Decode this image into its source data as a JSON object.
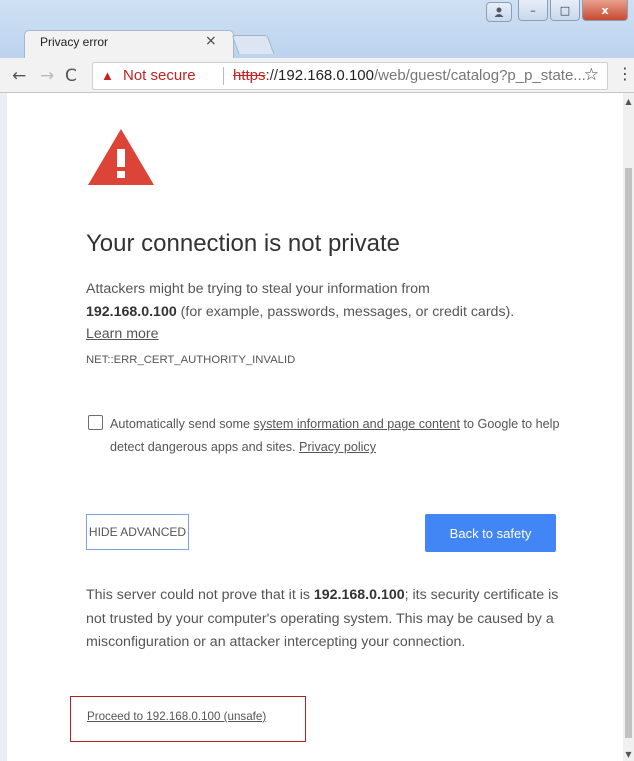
{
  "tab": {
    "title": "Privacy error",
    "close": "×"
  },
  "window": {
    "close": "x",
    "minimize": "–",
    "maximize": "□"
  },
  "toolbar": {
    "back": "←",
    "forward": "→",
    "reload": "C",
    "not_secure": "Not secure",
    "url_scheme": "https",
    "url_sep": "://",
    "url_host": "192.168.0.100",
    "url_path": "/web/guest/catalog?p_p_state...",
    "bookmark": "☆",
    "menu": "⋮"
  },
  "page": {
    "heading": "Your connection is not private",
    "para_1": "Attackers might be trying to steal your information from",
    "para_host": "192.168.0.100",
    "para_2": " (for example, passwords, messages, or credit cards).",
    "learn_more": "Learn more",
    "error_code": "NET::ERR_CERT_AUTHORITY_INVALID",
    "checkbox_pre": "Automatically send some ",
    "checkbox_link": "system information and page content",
    "checkbox_post": " to Google to help detect dangerous apps and sites. ",
    "privacy_policy": "Privacy policy",
    "hide_advanced": "HIDE ADVANCED",
    "back_to_safety": "Back to safety",
    "detail_1": "This server could not prove that it is ",
    "detail_host": "192.168.0.100",
    "detail_2": "; its security certificate is not trusted by your computer's operating system. This may be caused by a misconfiguration or an attacker intercepting your connection.",
    "proceed": "Proceed to 192.168.0.100 (unsafe)"
  },
  "colors": {
    "danger": "#db4437",
    "accent": "#4285f4",
    "highlight_box": "#b42020"
  }
}
